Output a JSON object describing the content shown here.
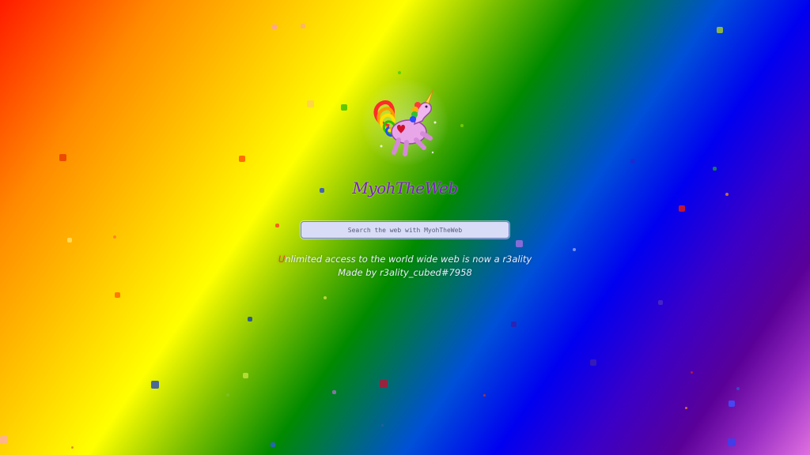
{
  "brand": {
    "name": "MyohTheWeb",
    "logo_icon": "unicorn-icon"
  },
  "search": {
    "placeholder": "Search the web with MyohTheWeb",
    "value": ""
  },
  "tagline": {
    "line1_first_letter": "U",
    "line1_rest": "nlimited access to the world wide web is now a r3ality",
    "line2": "Made by r3ality_cubed#7958"
  },
  "colors": {
    "brand_text": "#7a1fc0",
    "search_bg": "#d9dcf6",
    "search_border": "#6a7bd0",
    "tagline_text": "#e8f0ff"
  }
}
